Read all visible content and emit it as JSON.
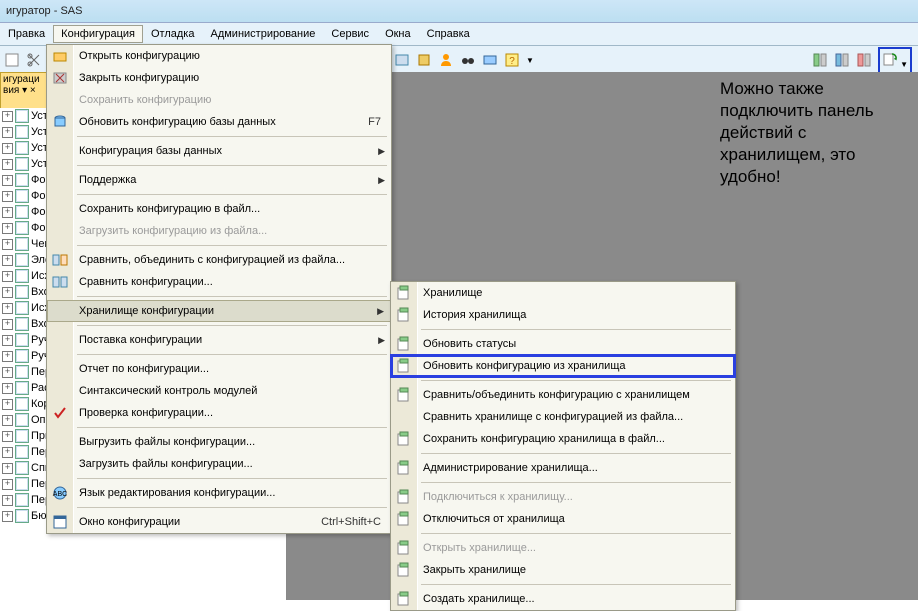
{
  "title": "игуратор - SAS",
  "menubar": [
    "Правка",
    "Конфигурация",
    "Отладка",
    "Администрирование",
    "Сервис",
    "Окна",
    "Справка"
  ],
  "leftHeader": "игураци\nвия ▾  ×",
  "tree": [
    {
      "t": "Уст",
      "lock": 1
    },
    {
      "t": "Уст",
      "lock": 1
    },
    {
      "t": "Уст",
      "lock": 1
    },
    {
      "t": "Уст",
      "lock": 1
    },
    {
      "t": "Фо",
      "lock": 1
    },
    {
      "t": "Фо",
      "lock": 1
    },
    {
      "t": "Фо",
      "lock": 1
    },
    {
      "t": "Фо",
      "lock": 1
    },
    {
      "t": "Чек",
      "lock": 1
    },
    {
      "t": "Эле",
      "lock": 1
    },
    {
      "t": "Исх",
      "lock": 1
    },
    {
      "t": "Вхо",
      "lock": 1
    },
    {
      "t": "Исх",
      "lock": 1
    },
    {
      "t": "Вхо",
      "lock": 1
    },
    {
      "t": "Руч",
      "lock": 1
    },
    {
      "t": "Руч",
      "lock": 1
    },
    {
      "t": "Пер",
      "lock": 1
    },
    {
      "t": "Рас",
      "lock": 1
    },
    {
      "t": "Кор",
      "lock": 1
    },
    {
      "t": "Опе",
      "lock": 1
    },
    {
      "t": "ПринятиеКУчетуОС",
      "lock": 1
    },
    {
      "t": "ПеремещениеОС",
      "lock": 1
    },
    {
      "t": "СписаниеОС",
      "lock": 1
    },
    {
      "t": "ПередачаОС",
      "lock": 1
    },
    {
      "t": "ПереоценкаОС",
      "lock": 1
    },
    {
      "t": "БюджетДоходовИРасходов",
      "lock": 1
    }
  ],
  "menu1": [
    {
      "t": "Открыть конфигурацию",
      "ic": "open"
    },
    {
      "t": "Закрыть конфигурацию",
      "ic": "close"
    },
    {
      "t": "Сохранить конфигурацию",
      "dis": 1
    },
    {
      "t": "Обновить конфигурацию базы данных",
      "ic": "db",
      "sc": "F7"
    },
    {
      "sep": 1
    },
    {
      "t": "Конфигурация базы данных",
      "sub": 1
    },
    {
      "sep": 1
    },
    {
      "t": "Поддержка",
      "sub": 1
    },
    {
      "sep": 1
    },
    {
      "t": "Сохранить конфигурацию в файл..."
    },
    {
      "t": "Загрузить конфигурацию из файла...",
      "dis": 1
    },
    {
      "sep": 1
    },
    {
      "t": "Сравнить, объединить с конфигурацией из файла...",
      "ic": "cmp"
    },
    {
      "t": "Сравнить конфигурации...",
      "ic": "cmp2"
    },
    {
      "sep": 1
    },
    {
      "t": "Хранилище конфигурации",
      "sub": 1,
      "hov": 1
    },
    {
      "sep": 1
    },
    {
      "t": "Поставка конфигурации",
      "sub": 1
    },
    {
      "sep": 1
    },
    {
      "t": "Отчет по конфигурации..."
    },
    {
      "t": "Синтаксический контроль модулей"
    },
    {
      "t": "Проверка конфигурации...",
      "ic": "chk"
    },
    {
      "sep": 1
    },
    {
      "t": "Выгрузить файлы конфигурации..."
    },
    {
      "t": "Загрузить файлы конфигурации..."
    },
    {
      "sep": 1
    },
    {
      "t": "Язык редактирования конфигурации...",
      "ic": "lang"
    },
    {
      "sep": 1
    },
    {
      "t": "Окно конфигурации",
      "ic": "win",
      "sc": "Ctrl+Shift+C"
    }
  ],
  "menu2": [
    {
      "t": "Хранилище",
      "ic": "g1"
    },
    {
      "t": "История хранилища",
      "ic": "g2"
    },
    {
      "sep": 1
    },
    {
      "t": "Обновить статусы",
      "ic": "g3"
    },
    {
      "t": "Обновить конфигурацию из хранилища",
      "ic": "g4",
      "hl": 1
    },
    {
      "sep": 1
    },
    {
      "t": "Сравнить/объединить конфигурацию с хранилищем",
      "ic": "g5"
    },
    {
      "t": "Сравнить хранилище с конфигурацией из файла..."
    },
    {
      "t": "Сохранить конфигурацию хранилища в файл...",
      "ic": "g6"
    },
    {
      "sep": 1
    },
    {
      "t": "Администрирование хранилища...",
      "ic": "g7"
    },
    {
      "sep": 1
    },
    {
      "t": "Подключиться к хранилищу...",
      "dis": 1,
      "ic": "g8"
    },
    {
      "t": "Отключиться от хранилища",
      "ic": "g9"
    },
    {
      "sep": 1
    },
    {
      "t": "Открыть хранилище...",
      "dis": 1,
      "ic": "g10"
    },
    {
      "t": "Закрыть хранилище",
      "ic": "g11"
    },
    {
      "sep": 1
    },
    {
      "t": "Создать хранилище...",
      "ic": "g12"
    }
  ],
  "annotation": "Можно также подключить панель действий с хранилищем, это удобно!"
}
